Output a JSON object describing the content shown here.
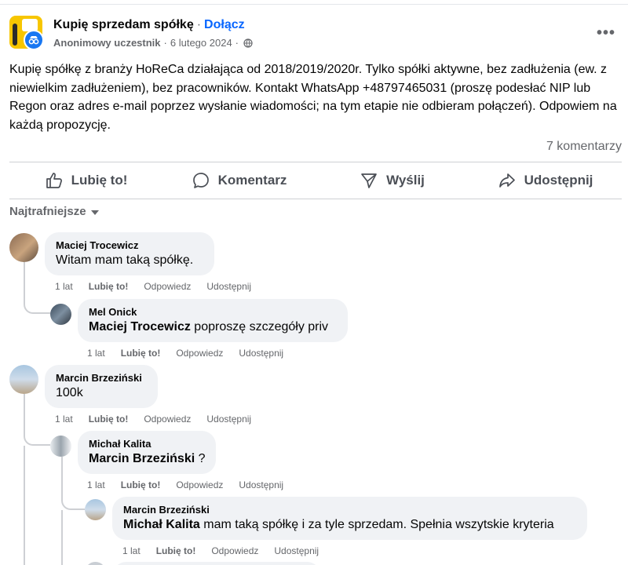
{
  "post": {
    "group_name": "Kupię sprzedam spółkę",
    "join_label": "Dołącz",
    "author": "Anonimowy uczestnik",
    "date": "6 lutego 2024",
    "text": "Kupię spółkę z branży HoReCa działająca od 2018/2019/2020r. Tylko spółki aktywne, bez zadłużenia (ew. z niewielkim zadłużeniem), bez pracowników. Kontakt WhatsApp +48797465031 (proszę podesłać NIP lub Regon oraz adres e-mail poprzez wysłanie wiadomości; na tym etapie nie odbieram połączeń). Odpowiem na każdą propozycję.",
    "comments_count": "7 komentarzy",
    "more_icon": "more-horizontal-icon"
  },
  "actions": {
    "like": "Lubię to!",
    "comment": "Komentarz",
    "send": "Wyślij",
    "share": "Udostępnij"
  },
  "sort_label": "Najtrafniejsze",
  "comments": [
    {
      "name": "Maciej Trocewicz",
      "mention": "",
      "text": "Witam mam taką spółkę.",
      "time": "1 lat",
      "like": "Lubię to!",
      "reply": "Odpowiedz",
      "share": "Udostępnij"
    },
    {
      "name": "Mel Onick",
      "mention": "Maciej Trocewicz",
      "text": "poproszę szczegóły priv",
      "time": "1 lat",
      "like": "Lubię to!",
      "reply": "Odpowiedz",
      "share": "Udostępnij"
    },
    {
      "name": "Marcin Brzeziński",
      "mention": "",
      "text": "100k",
      "time": "1 lat",
      "like": "Lubię to!",
      "reply": "Odpowiedz",
      "share": "Udostępnij"
    },
    {
      "name": "Michał Kalita",
      "mention": "Marcin Brzeziński",
      "text": "?",
      "time": "1 lat",
      "like": "Lubię to!",
      "reply": "Odpowiedz",
      "share": "Udostępnij"
    },
    {
      "name": "Marcin Brzeziński",
      "mention": "Michał Kalita",
      "text": "mam taką spółkę i za tyle sprzedam. Spełnia wszytskie kryteria",
      "time": "1 lat",
      "like": "Lubię to!",
      "reply": "Odpowiedz",
      "share": "Udostępnij"
    }
  ],
  "colors": {
    "link": "#0866ff",
    "bubble": "#f0f2f5",
    "secondary_text": "#65676b",
    "group_avatar": "#f7c600",
    "anon_badge": "#1877f2"
  }
}
